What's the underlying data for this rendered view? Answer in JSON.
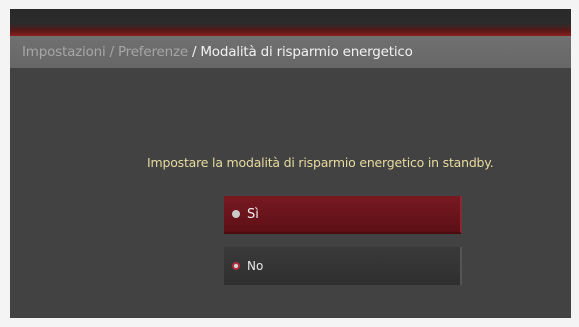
{
  "breadcrumb": {
    "item1": "Impostazioni",
    "separator1": "/",
    "item2": "Preferenze",
    "separator2": "/",
    "current": "Modalità di risparmio energetico"
  },
  "prompt": "Impostare la modalità di risparmio energetico in standby.",
  "options": [
    {
      "label": "Sì",
      "focused": true,
      "selected": false
    },
    {
      "label": "No",
      "focused": false,
      "selected": true
    }
  ],
  "colors": {
    "background": "#424242",
    "breadcrumb_bar": "#6c6c6c",
    "accent_red": "#6e141b",
    "prompt_text": "#e6dba0"
  }
}
